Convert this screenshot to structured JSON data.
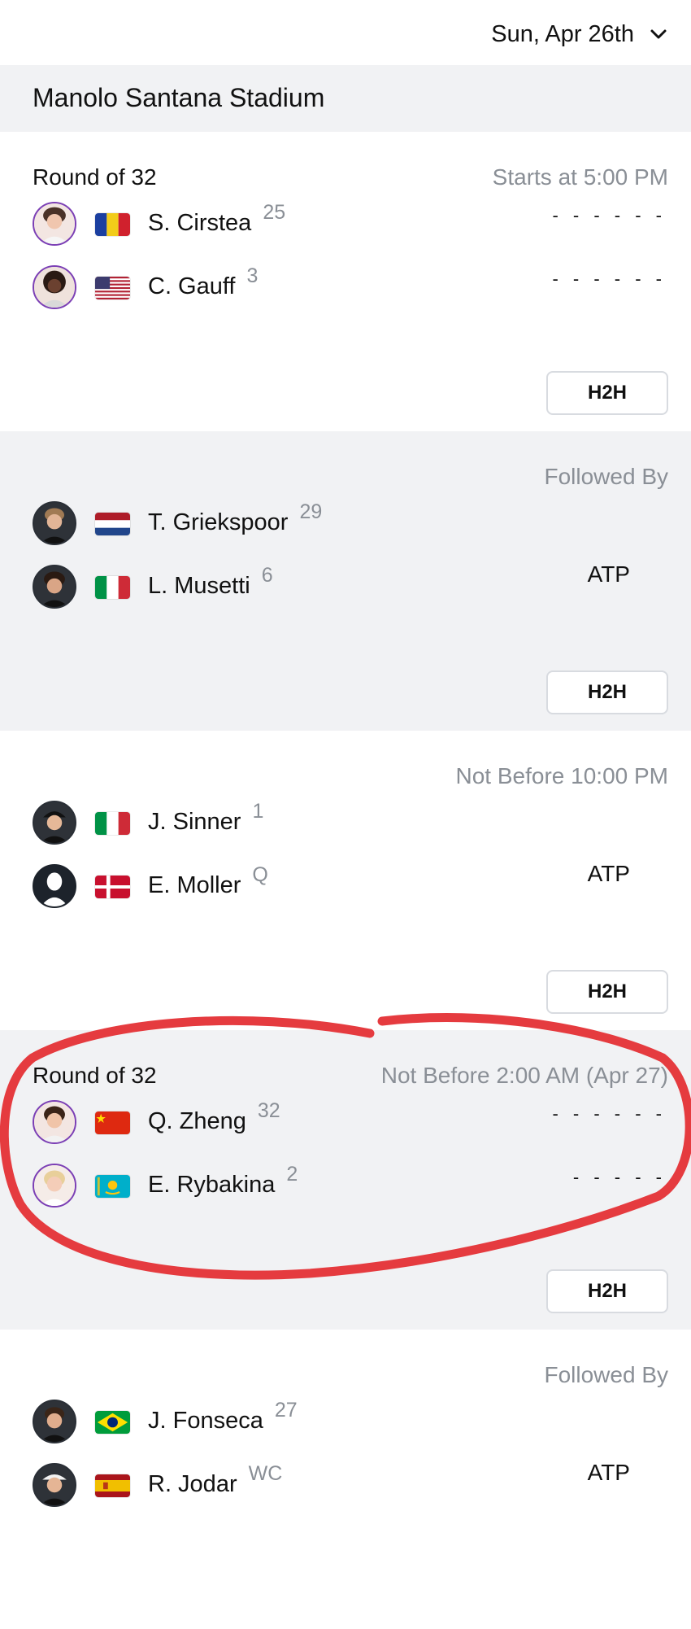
{
  "header": {
    "date_label": "Sun, Apr 26th"
  },
  "venue": {
    "name": "Manolo Santana Stadium"
  },
  "matches": [
    {
      "round": "Round of 32",
      "status": "Starts at 5:00 PM",
      "tour": "",
      "h2h_label": "H2H",
      "players": [
        {
          "name": "S. Cirstea",
          "seed": "25",
          "flag": "romania-flag",
          "score": "- - - - - -"
        },
        {
          "name": "C. Gauff",
          "seed": "3",
          "flag": "usa-flag",
          "score": "- - - - - -"
        }
      ]
    },
    {
      "round": "",
      "status": "Followed By",
      "tour": "ATP",
      "h2h_label": "H2H",
      "players": [
        {
          "name": "T. Griekspoor",
          "seed": "29",
          "flag": "netherlands-flag",
          "score": ""
        },
        {
          "name": "L. Musetti",
          "seed": "6",
          "flag": "italy-flag",
          "score": ""
        }
      ]
    },
    {
      "round": "",
      "status": "Not Before 10:00 PM",
      "tour": "ATP",
      "h2h_label": "H2H",
      "players": [
        {
          "name": "J. Sinner",
          "seed": "1",
          "flag": "italy-flag",
          "score": ""
        },
        {
          "name": "E. Moller",
          "seed": "Q",
          "flag": "denmark-flag",
          "score": ""
        }
      ]
    },
    {
      "round": "Round of 32",
      "status": "Not Before 2:00 AM (Apr 27)",
      "tour": "",
      "h2h_label": "H2H",
      "players": [
        {
          "name": "Q. Zheng",
          "seed": "32",
          "flag": "china-flag",
          "score": "- - - - - -"
        },
        {
          "name": "E. Rybakina",
          "seed": "2",
          "flag": "kazakhstan-flag",
          "score": "- - - - -"
        }
      ]
    },
    {
      "round": "",
      "status": "Followed By",
      "tour": "ATP",
      "h2h_label": "",
      "players": [
        {
          "name": "J. Fonseca",
          "seed": "27",
          "flag": "brazil-flag",
          "score": ""
        },
        {
          "name": "R. Jodar",
          "seed": "WC",
          "flag": "spain-flag",
          "score": ""
        }
      ]
    }
  ],
  "colors": {
    "wta_avatar_ring": "#7b3fb5",
    "muted_text": "#8a8f96",
    "grey_bg": "#f1f2f4",
    "annotation_red": "#e53b3f"
  }
}
